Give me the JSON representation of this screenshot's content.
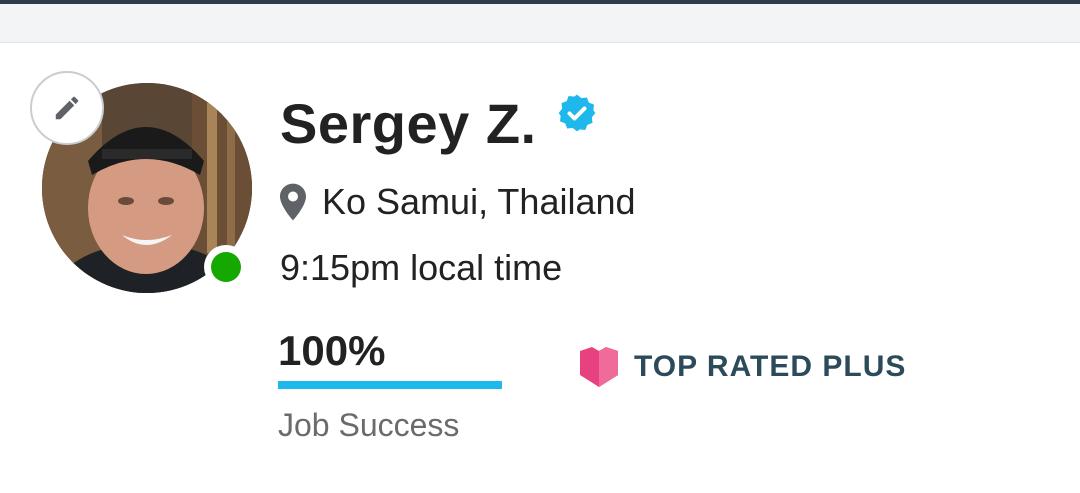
{
  "profile": {
    "name": "Sergey Z.",
    "location": "Ko Samui, Thailand",
    "local_time": "9:15pm local time",
    "job_success": {
      "value": "100%",
      "label": "Job Success",
      "percent": 100
    },
    "badge": "TOP RATED PLUS",
    "status": "online"
  },
  "icons": {
    "edit": "pencil-icon",
    "verified": "verified-badge-icon",
    "location": "map-pin-icon",
    "badge": "top-rated-plus-icon"
  },
  "colors": {
    "online": "#14a800",
    "verified": "#1fb8ec",
    "progress": "#1fb8ec",
    "badge_icon": "#e8417f",
    "badge_text": "#2b4a5a"
  }
}
